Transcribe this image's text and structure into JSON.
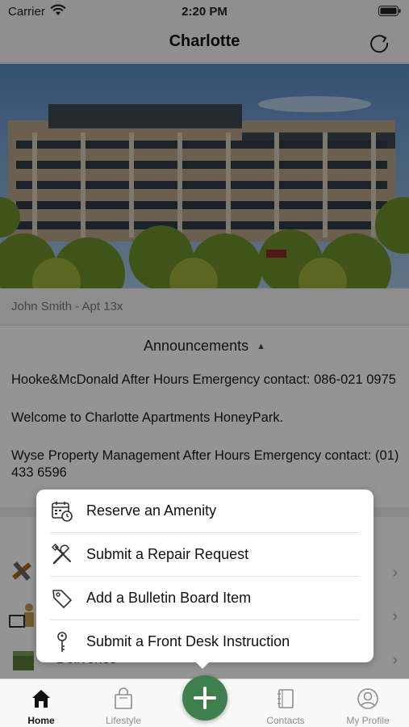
{
  "status_bar": {
    "carrier": "Carrier",
    "time": "2:20 PM"
  },
  "nav": {
    "title": "Charlotte"
  },
  "resident": {
    "text": "John Smith - Apt 13x"
  },
  "announcements": {
    "header": "Announcements",
    "items": [
      "Hooke&McDonald After Hours Emergency contact: 086-021 0975",
      "Welcome to Charlotte Apartments HoneyPark.",
      "Wyse Property Management After Hours Emergency contact: (01) 433 6596"
    ]
  },
  "services": [
    {
      "label": "",
      "icon": "tools-icon"
    },
    {
      "label": "",
      "icon": "front-desk-icon"
    },
    {
      "label": "Deliveries",
      "icon": "package-icon"
    }
  ],
  "menu": {
    "items": [
      {
        "label": "Reserve an Amenity",
        "icon": "calendar-clock-icon"
      },
      {
        "label": "Submit a Repair Request",
        "icon": "tools-icon"
      },
      {
        "label": "Add a Bulletin Board Item",
        "icon": "tag-icon"
      },
      {
        "label": "Submit a Front Desk Instruction",
        "icon": "key-icon"
      }
    ]
  },
  "tabs": [
    {
      "label": "Home",
      "icon": "home-icon",
      "active": true
    },
    {
      "label": "Lifestyle",
      "icon": "shopping-bag-icon",
      "active": false
    },
    {
      "label": "Contacts",
      "icon": "contacts-book-icon",
      "active": false
    },
    {
      "label": "My Profile",
      "icon": "profile-icon",
      "active": false
    }
  ],
  "colors": {
    "accent": "#3f7f4e",
    "overlay": "rgba(0,0,0,0.42)"
  }
}
